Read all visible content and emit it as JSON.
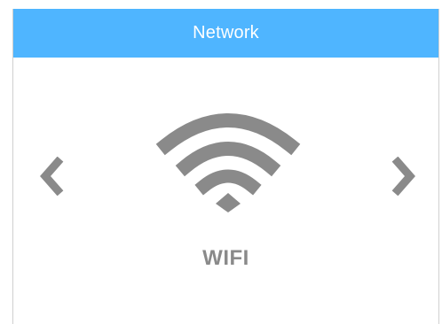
{
  "header": {
    "title": "Network"
  },
  "carousel": {
    "prev_icon": "chevron-left-icon",
    "next_icon": "chevron-right-icon",
    "current_icon": "wifi-icon",
    "current_label": "WIFI"
  },
  "colors": {
    "header_bg": "#4fb5ff",
    "header_text": "#ffffff",
    "icon": "#8a8a8a",
    "label": "#8a8a8a"
  }
}
